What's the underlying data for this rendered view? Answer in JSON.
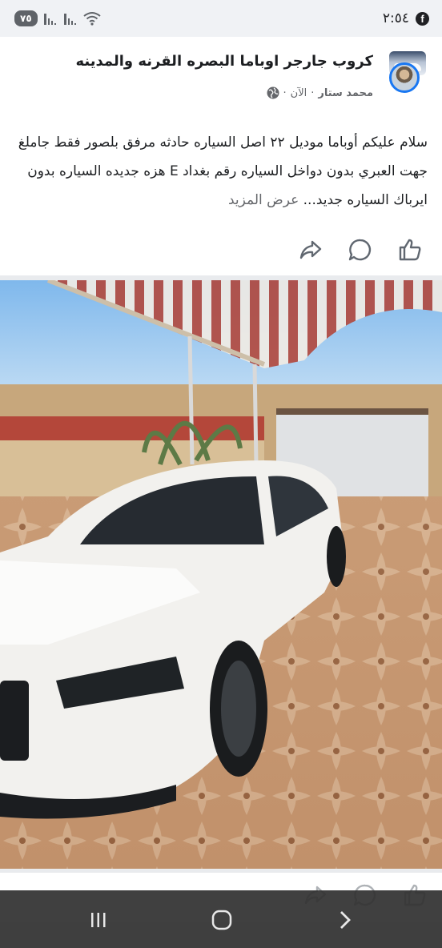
{
  "status_bar": {
    "time": "٢:٥٤",
    "battery": "٧٥",
    "app_badge": "f"
  },
  "post": {
    "group_name": "كروب جارجر اوباما البصره القرنه والمدينه",
    "author": "محمد ستار",
    "separator": "·",
    "timestamp": "الآن",
    "text": "سلام عليكم أوباما موديل ٢٢ اصل السياره حادثه مرفق بلصور فقط جاملغ جهت العبري بدون دواخل السياره رقم بغداد E هزه جديده السياره بدون ايرباك السياره جديد...",
    "see_more": "عرض المزيد"
  },
  "icons": {
    "share": "share-icon",
    "comment": "comment-icon",
    "like": "like-icon",
    "globe": "globe-icon"
  },
  "colors": {
    "accent": "#1877f2",
    "meta_text": "#65676b",
    "icon": "#606770"
  }
}
